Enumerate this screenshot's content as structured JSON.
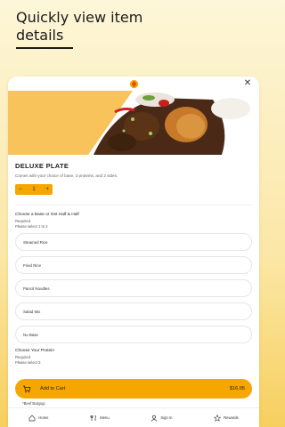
{
  "promo": {
    "title": "Quickly view item details"
  },
  "modal": {
    "close_label": "✕",
    "item": {
      "name": "DELUXE PLATE",
      "description": "Comes with your choice of base, 3 proteins, and 2 sides.",
      "quantity": {
        "decrement": "−",
        "value": "1",
        "increment": "+"
      }
    },
    "group1": {
      "title": "Choose a Base or Get Half & Half",
      "required": "Required",
      "hint": "Please select 1 to 2",
      "options": [
        "Steamed Rice",
        "Fried Rice",
        "Pancit Noodles",
        "Salad Mix",
        "No Base"
      ]
    },
    "group2": {
      "title": "Choose Your Protein",
      "required": "Required",
      "hint": "Please select 3"
    },
    "cart": {
      "label": "Add to Cart",
      "price": "$16.95"
    },
    "behind_text": "*Beef Bulgogi",
    "nav": {
      "items": [
        {
          "label": "Home",
          "icon": "home-icon"
        },
        {
          "label": "Menu",
          "icon": "utensils-icon"
        },
        {
          "label": "Sign In",
          "icon": "user-icon"
        },
        {
          "label": "Rewards",
          "icon": "star-icon"
        }
      ]
    }
  },
  "colors": {
    "accent": "#f5a700",
    "hero_background": "#f7c35a",
    "background_top": "#fdf6d8",
    "background_bottom": "#f7cf5e"
  }
}
